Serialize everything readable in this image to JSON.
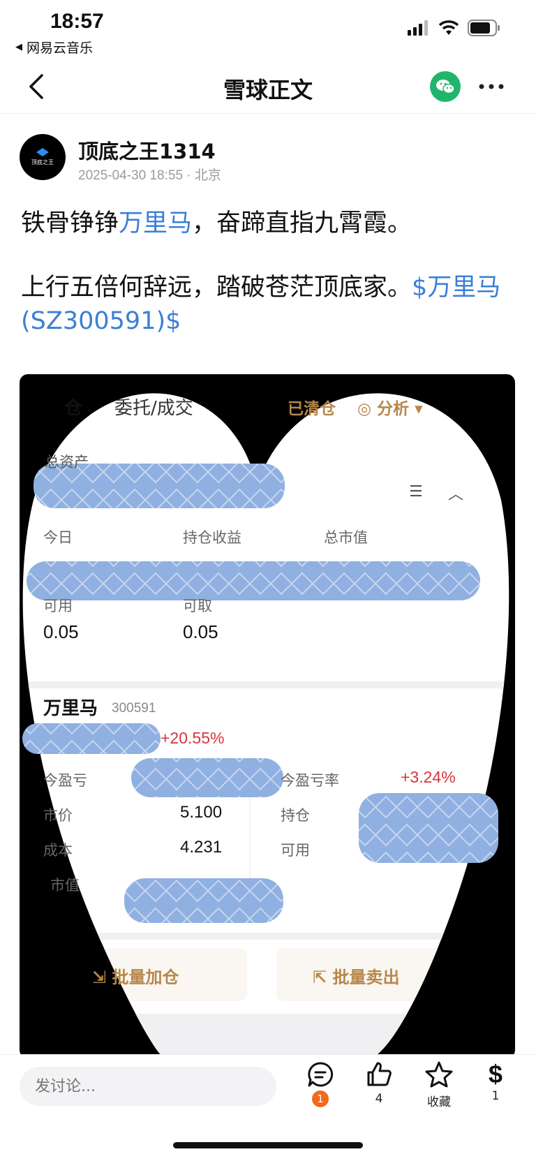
{
  "status_bar": {
    "time": "18:57",
    "back_app": "网易云音乐"
  },
  "nav": {
    "title": "雪球正文"
  },
  "author": {
    "name": "顶底之王1314",
    "timestamp": "2025-04-30 18:55",
    "location": "北京",
    "avatar_text": "顶底之王"
  },
  "post": {
    "line1_pre": "铁骨铮铮",
    "line1_link": "万里马",
    "line1_post": "，奋蹄直指九霄霞。",
    "line2_pre": "上行五倍何辞远，踏破苍茫顶底家。",
    "line2_link": "$万里马(SZ300591)$"
  },
  "screenshot": {
    "tab_hold": "仓",
    "tab_orders": "委托/成交",
    "cleared": "已清仓",
    "analysis": "分析",
    "total_assets": "总资产",
    "today": "今日",
    "hold_profit": "持仓收益",
    "market_value_total": "总市值",
    "available": "可用",
    "withdrawable": "可取",
    "available_value": "0.05",
    "withdrawable_value": "0.05",
    "stock_name": "万里马",
    "stock_code": "300591",
    "stock_pct": "+20.55%",
    "today_pl": "今盈亏",
    "today_pl_rate": "今盈亏率",
    "today_pl_rate_value": "+3.24%",
    "price": "市价",
    "price_value": "5.100",
    "position": "持仓",
    "cost": "成本",
    "cost_value": "4.231",
    "available2": "可用",
    "market_value": "市值",
    "batch_add": "批量加仓",
    "batch_sell": "批量卖出"
  },
  "bottom_bar": {
    "comment_placeholder": "发讨论...",
    "comment_count": "1",
    "like_count": "4",
    "favorite_label": "收藏",
    "reward_count": "1"
  },
  "colors": {
    "accent_link": "#3a7fd6",
    "up_red": "#d9343a",
    "gold": "#b8874a",
    "wechat_green": "#20b56c",
    "badge_orange": "#f26a1b"
  }
}
